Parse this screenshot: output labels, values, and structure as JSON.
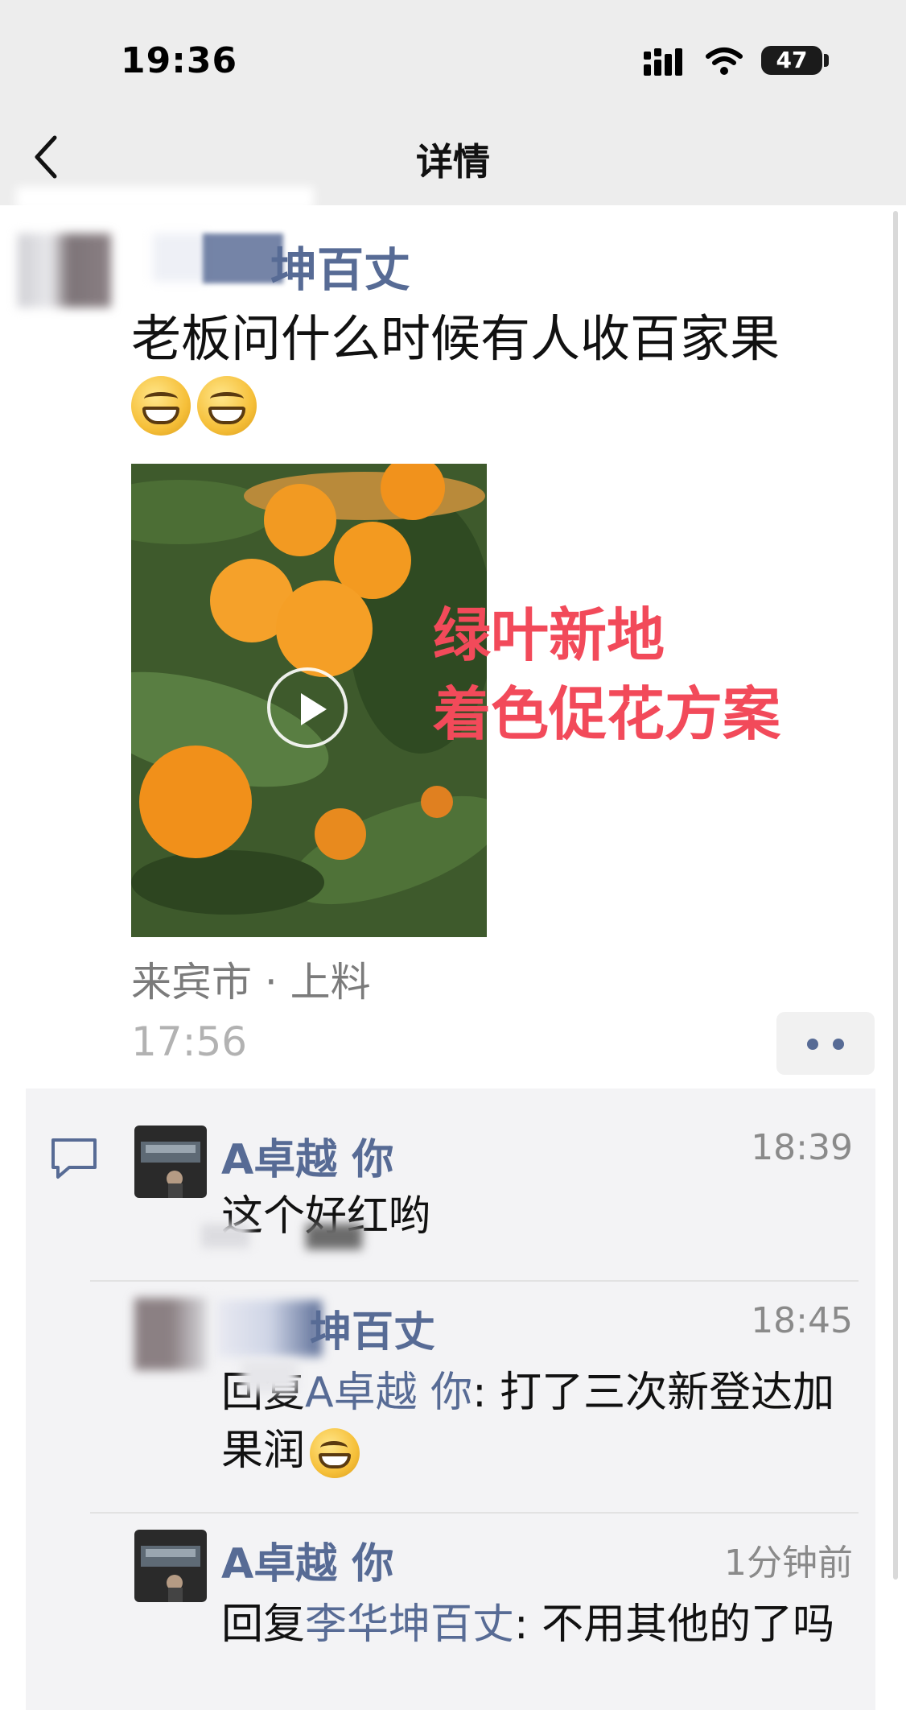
{
  "status_bar": {
    "time": "19:36",
    "battery": "47"
  },
  "nav": {
    "title": "详情",
    "back_icon": "chevron-left-icon"
  },
  "post": {
    "author": "坤百丈",
    "text": "老板问什么时候有人收百家果",
    "emoji": "grin-emoji",
    "video_overlay_line1": "绿叶新地",
    "video_overlay_line2": "着色促花方案",
    "location": "来宾市 · 上料",
    "time": "17:56"
  },
  "comments": [
    {
      "author": "A卓越 你",
      "time": "18:39",
      "text": "这个好红哟"
    },
    {
      "author": "坤百丈",
      "time": "18:45",
      "reply_prefix": "回复",
      "reply_to": "A卓越 你",
      "text": ": 打了三次新登达加果润"
    },
    {
      "author": "A卓越 你",
      "time": "1分钟前",
      "reply_prefix": "回复",
      "reply_to": "李华坤百丈",
      "text": ": 不用其他的了吗"
    }
  ],
  "colors": {
    "link": "#576b95",
    "overlay_red": "#f24a5a",
    "nav_bg": "#ededed",
    "comment_bg": "#f3f3f5"
  }
}
